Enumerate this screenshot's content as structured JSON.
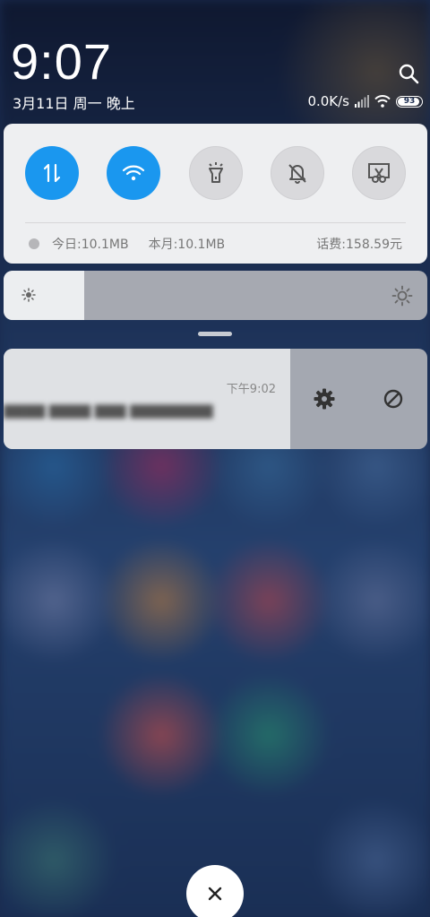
{
  "status": {
    "time": "9:07",
    "date": "3月11日 周一 晚上",
    "net_speed": "0.0K/s",
    "battery_level": "93",
    "battery_fraction": 0.93
  },
  "quick_toggles": [
    {
      "name": "mobile-data",
      "icon": "data-arrows-icon",
      "active": true
    },
    {
      "name": "wifi",
      "icon": "wifi-icon",
      "active": true
    },
    {
      "name": "flashlight",
      "icon": "flashlight-icon",
      "active": false
    },
    {
      "name": "mute",
      "icon": "bell-off-icon",
      "active": false
    },
    {
      "name": "screenshot",
      "icon": "scissors-icon",
      "active": false
    }
  ],
  "usage": {
    "today": "今日:10.1MB",
    "month": "本月:10.1MB",
    "fee": "话费:158.59元"
  },
  "brightness": {
    "level_fraction": 0.19
  },
  "notification": {
    "time": "下午9:02",
    "text": "▇▇▇▇ ▇▇▇▇ ▇▇▇ ▇▇▇▇▇▇▇▇"
  },
  "colors": {
    "accent": "#1a97ef",
    "panel": "#eeeff1"
  }
}
